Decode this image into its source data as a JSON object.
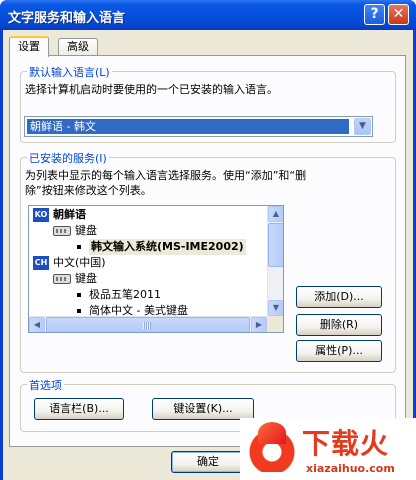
{
  "window": {
    "title": "文字服务和输入语言",
    "help_glyph": "?",
    "close_glyph": "✕"
  },
  "tabs": [
    {
      "label": "设置",
      "active": true
    },
    {
      "label": "高级",
      "active": false
    }
  ],
  "default_language": {
    "group_title": "默认输入语言(L)",
    "description": "选择计算机启动时要使用的一个已安装的输入语言。",
    "selected": "朝鲜语 - 韩文"
  },
  "installed_services": {
    "group_title": "已安装的服务(I)",
    "description_line1": "为列表中显示的每个输入语言选择服务。使用“添加”和“删",
    "description_line2": "除”按钮来修改这个列表。",
    "tree": [
      {
        "badge": "KO",
        "label": "朝鲜语"
      },
      {
        "label": "键盘"
      },
      {
        "label": "韩文输入系统(MS-IME2002)",
        "selected": true
      },
      {
        "badge": "CH",
        "label": "中文(中国)"
      },
      {
        "label": "键盘"
      },
      {
        "label": "极品五笔2011"
      },
      {
        "label": "简体中文 - 美式键盘"
      }
    ],
    "buttons": {
      "add": "添加(D)...",
      "remove": "删除(R)",
      "properties": "属性(P)..."
    }
  },
  "preferences": {
    "group_title": "首选项",
    "language_bar_button": "语言栏(B)...",
    "key_settings_button": "键设置(K)..."
  },
  "footer": {
    "ok_button": "确定"
  },
  "watermark": {
    "main": "下载火",
    "sub": "xiazaihuo.com"
  },
  "colors": {
    "titlebar": "#0550dc",
    "dialog_bg": "#ece9d8",
    "group_title": "#0046d5",
    "selection": "#316ac5",
    "logo": "#e53a1e"
  }
}
